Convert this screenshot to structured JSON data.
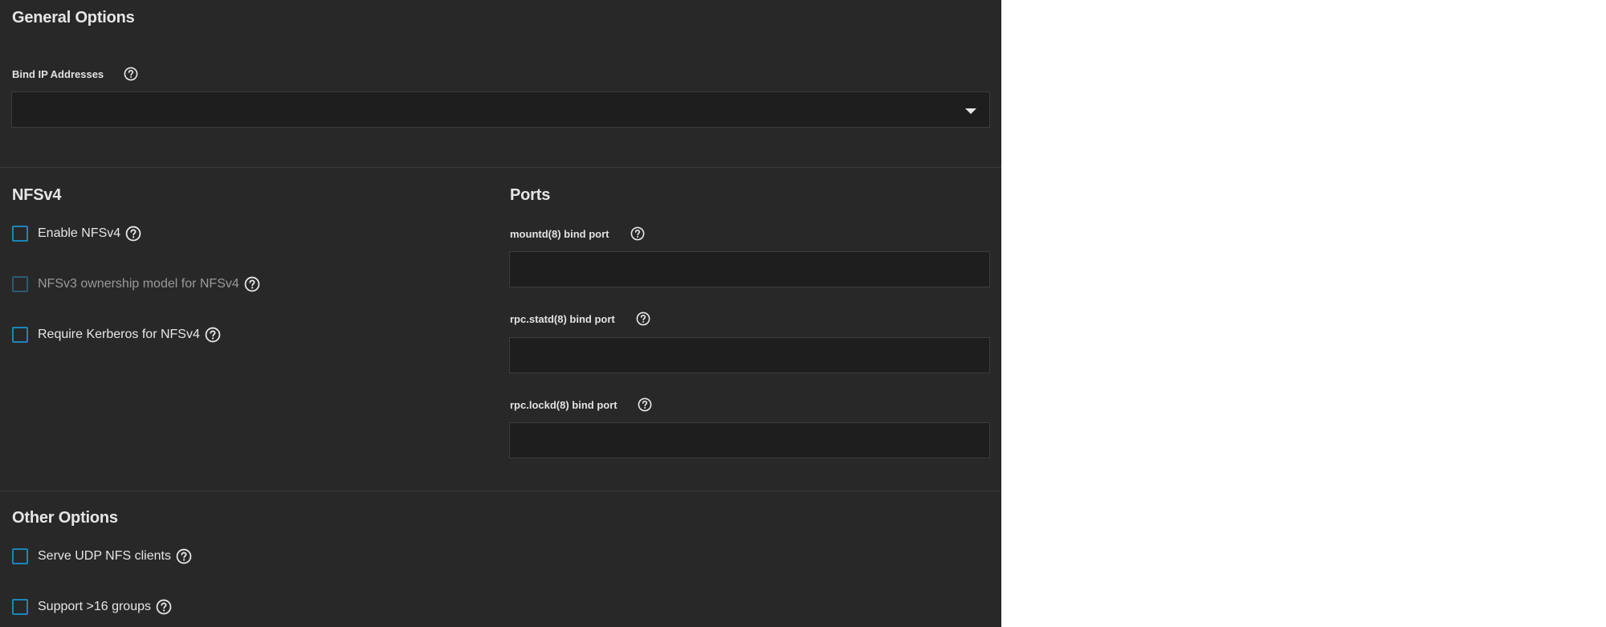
{
  "general": {
    "title": "General Options",
    "bind_ip_label": "Bind IP Addresses",
    "bind_ip_value": ""
  },
  "nfsv4": {
    "title": "NFSv4",
    "options": [
      {
        "label": "Enable NFSv4",
        "checked": false,
        "disabled": false
      },
      {
        "label": "NFSv3 ownership model for NFSv4",
        "checked": false,
        "disabled": true
      },
      {
        "label": "Require Kerberos for NFSv4",
        "checked": false,
        "disabled": false
      }
    ]
  },
  "ports": {
    "title": "Ports",
    "fields": [
      {
        "label": "mountd(8) bind port",
        "value": ""
      },
      {
        "label": "rpc.statd(8) bind port",
        "value": ""
      },
      {
        "label": "rpc.lockd(8) bind port",
        "value": ""
      }
    ]
  },
  "other": {
    "title": "Other Options",
    "options": [
      {
        "label": "Serve UDP NFS clients",
        "checked": false
      },
      {
        "label": "Support >16 groups",
        "checked": false
      }
    ]
  },
  "colors": {
    "panel_bg": "#282828",
    "input_bg": "#1e1e1e",
    "checkbox_border": "#1a86b8",
    "text": "#e6e6e6"
  },
  "icons": {
    "help": "help-circle-icon",
    "dropdown": "caret-down-icon"
  }
}
